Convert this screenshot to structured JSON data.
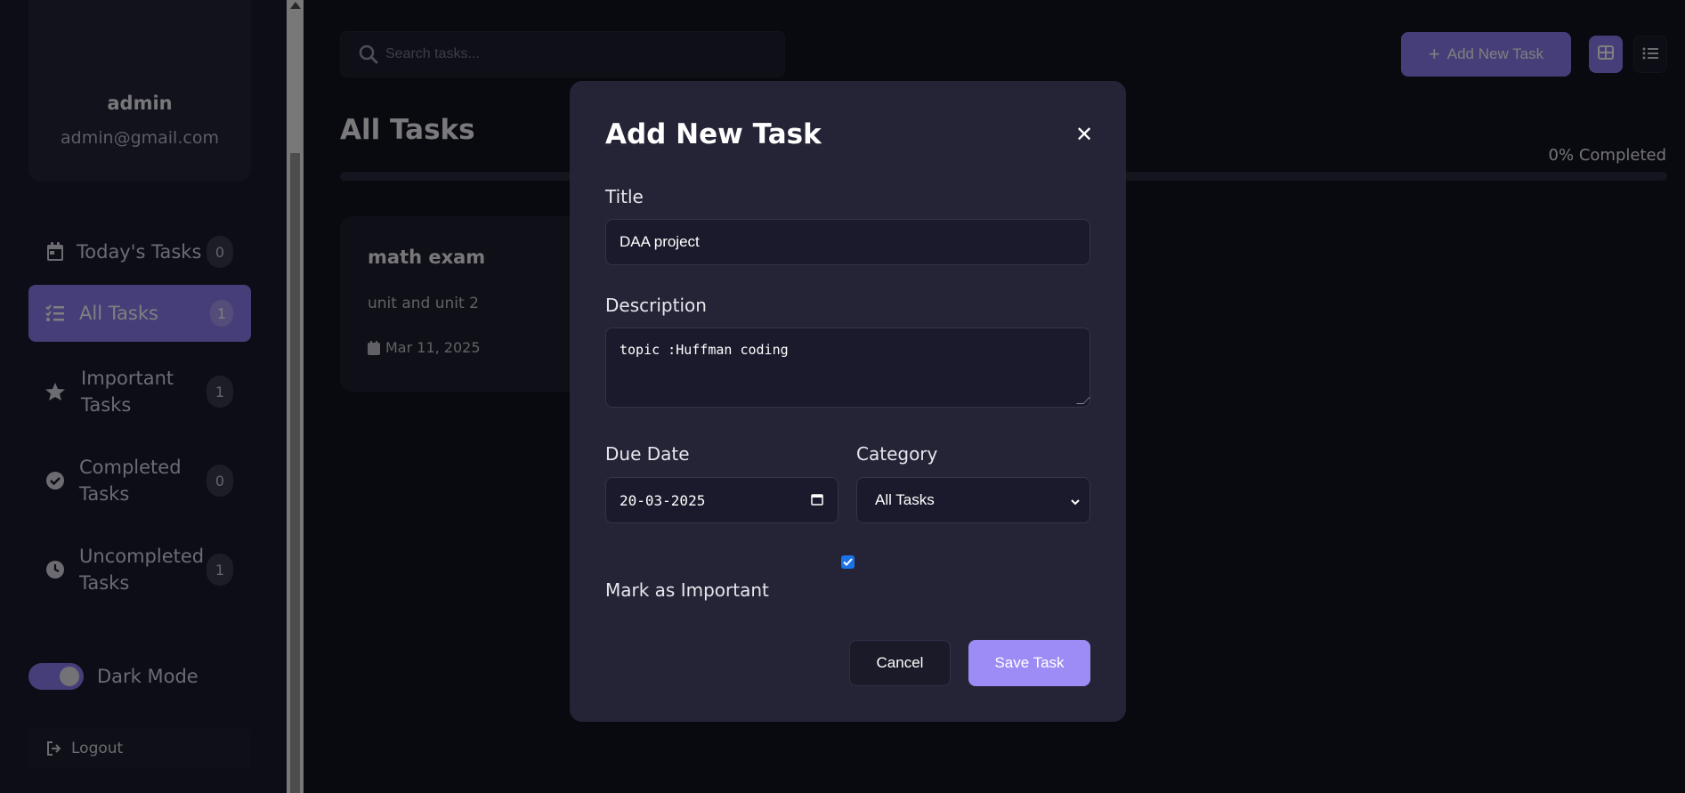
{
  "sidebar": {
    "profile": {
      "name": "admin",
      "email": "admin@gmail.com"
    },
    "items": [
      {
        "label": "Today's Tasks",
        "count": "0",
        "icon": "calendar-icon"
      },
      {
        "label": "All Tasks",
        "count": "1",
        "icon": "list-check-icon",
        "active": true
      },
      {
        "label": "Important Tasks",
        "count": "1",
        "icon": "star-icon"
      },
      {
        "label": "Completed Tasks",
        "count": "0",
        "icon": "check-circle-icon"
      },
      {
        "label": "Uncompleted Tasks",
        "count": "1",
        "icon": "clock-icon"
      }
    ],
    "dark_mode_label": "Dark Mode",
    "dark_mode_on": true,
    "logout_label": "Logout"
  },
  "header": {
    "search_placeholder": "Search tasks...",
    "add_button_label": "Add New Task"
  },
  "main": {
    "title": "All Tasks",
    "progress_text": "0% Completed",
    "progress_percent": 0,
    "tasks": [
      {
        "title": "math exam",
        "description": "unit and unit 2",
        "date": "Mar 11, 2025"
      }
    ]
  },
  "modal": {
    "title": "Add New Task",
    "close_glyph": "✕",
    "title_label": "Title",
    "title_value": "DAA project",
    "description_label": "Description",
    "description_value": "topic :Huffman coding",
    "due_date_label": "Due Date",
    "due_date_value": "20-03-2025",
    "category_label": "Category",
    "category_value": "All Tasks",
    "important_label": "Mark as Important",
    "important_checked": true,
    "cancel_label": "Cancel",
    "save_label": "Save Task"
  },
  "colors": {
    "accent": "#8d7cf0",
    "background": "#121220",
    "sidebar": "#1a1a2e",
    "modal": "#242436"
  }
}
